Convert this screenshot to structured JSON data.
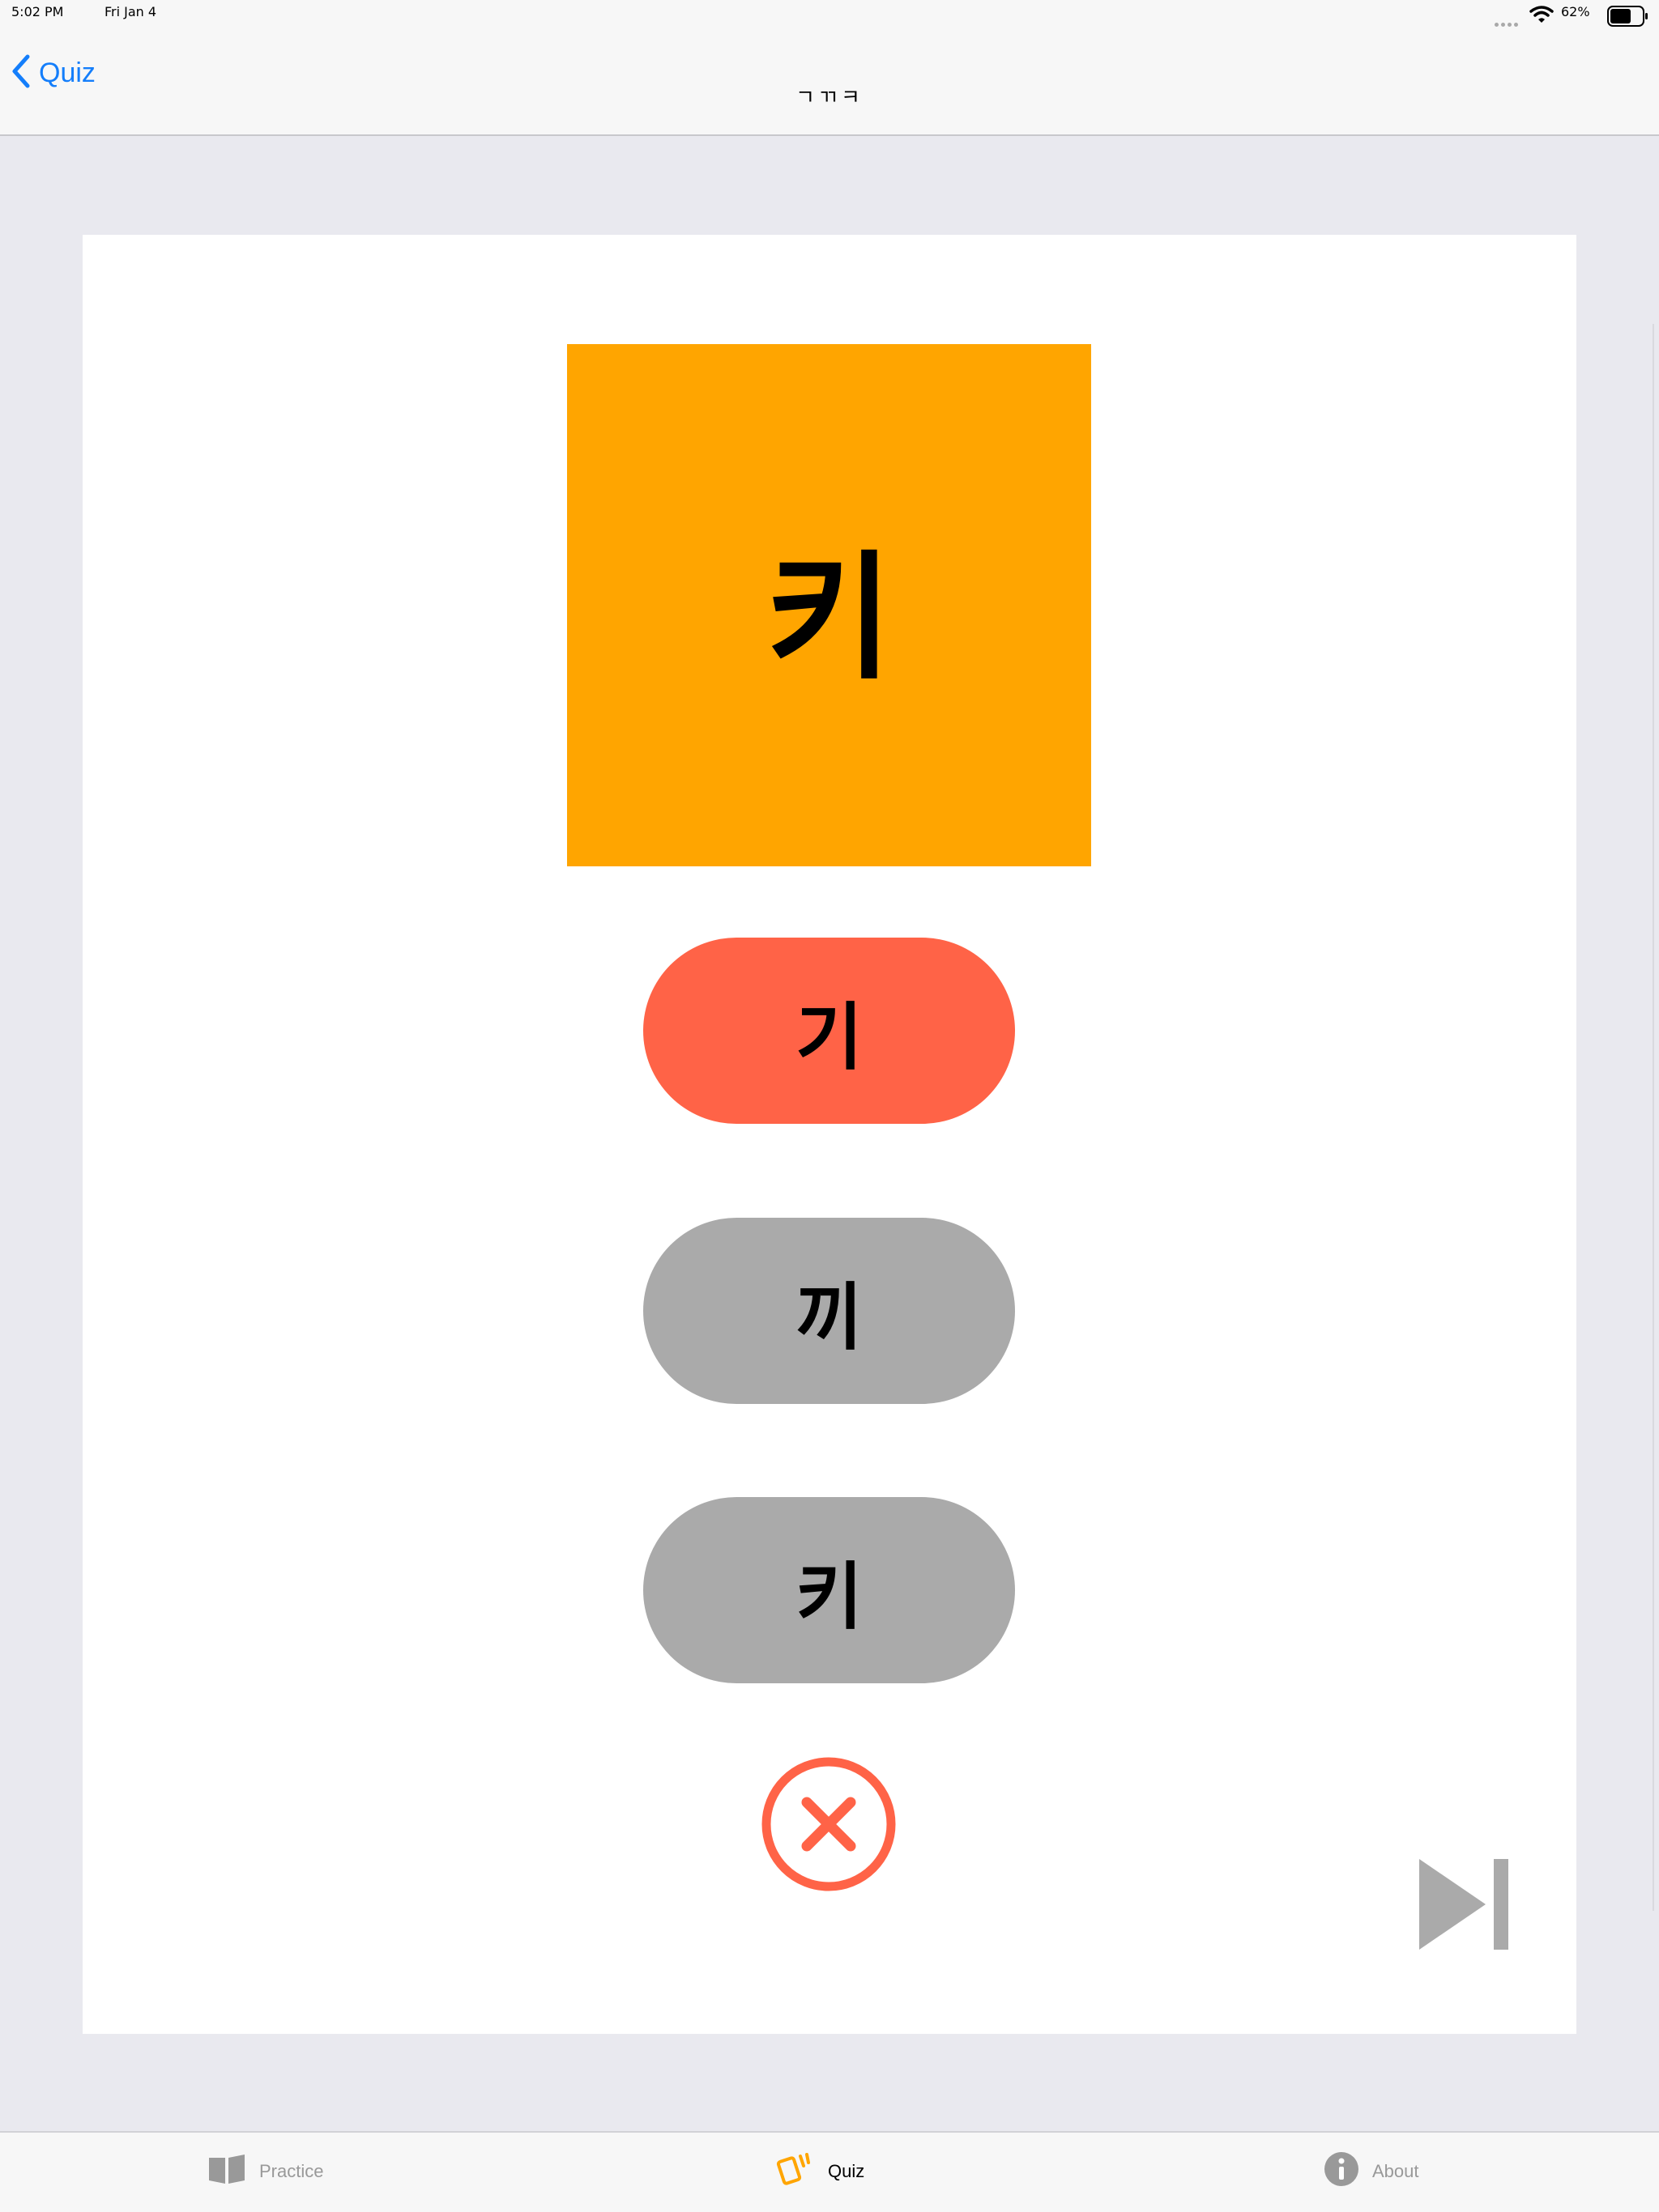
{
  "status_bar": {
    "time": "5:02 PM",
    "date": "Fri Jan 4",
    "battery": "62%"
  },
  "nav": {
    "back_label": "Quiz",
    "title": "ㄱㄲㅋ"
  },
  "quiz": {
    "prompt": "키",
    "prompt_color": "#ffa500",
    "choices": [
      {
        "label": "기",
        "color": "#ff6347"
      },
      {
        "label": "끼",
        "color": "#aaaaaa"
      },
      {
        "label": "키",
        "color": "#aaaaaa"
      }
    ],
    "result_icon": "x-circle-icon",
    "result_color": "#ff6347",
    "skip_icon": "skip-forward-icon"
  },
  "tabs": [
    {
      "label": "Practice",
      "icon": "book-icon",
      "selected": false
    },
    {
      "label": "Quiz",
      "icon": "cards-icon",
      "selected": true
    },
    {
      "label": "About",
      "icon": "info-icon",
      "selected": false
    }
  ],
  "colors": {
    "accent": "#147efb",
    "quiz_tab": "#ffa500",
    "inactive": "#999999"
  }
}
